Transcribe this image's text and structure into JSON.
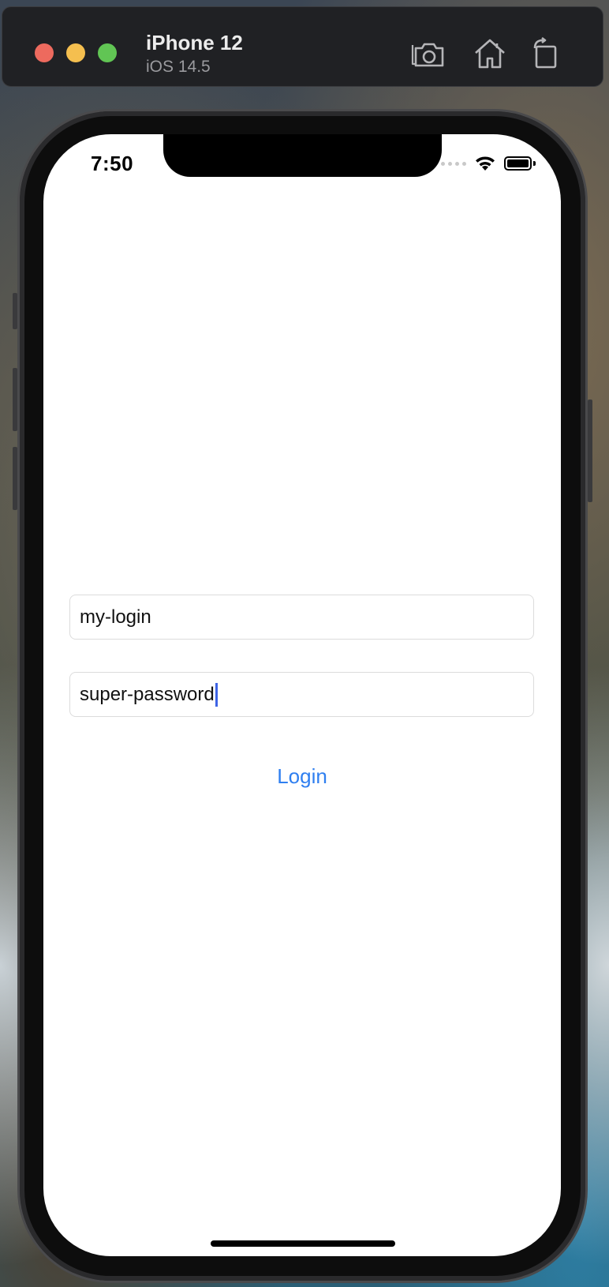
{
  "window": {
    "device_name": "iPhone 12",
    "os_version": "iOS 14.5",
    "toolbar_icons": [
      "screenshot-icon",
      "home-icon",
      "rotate-icon"
    ]
  },
  "status_bar": {
    "time": "7:50",
    "icons": [
      "cellular-icon",
      "wifi-icon",
      "battery-icon"
    ]
  },
  "form": {
    "login_value": "my-login",
    "password_value": "super-password",
    "login_button": "Login"
  },
  "colors": {
    "accent": "#2f7ff0",
    "caret": "#3e64e5",
    "close": "#ed6a5e",
    "minimize": "#f5bf4f",
    "maximize": "#61c554"
  }
}
